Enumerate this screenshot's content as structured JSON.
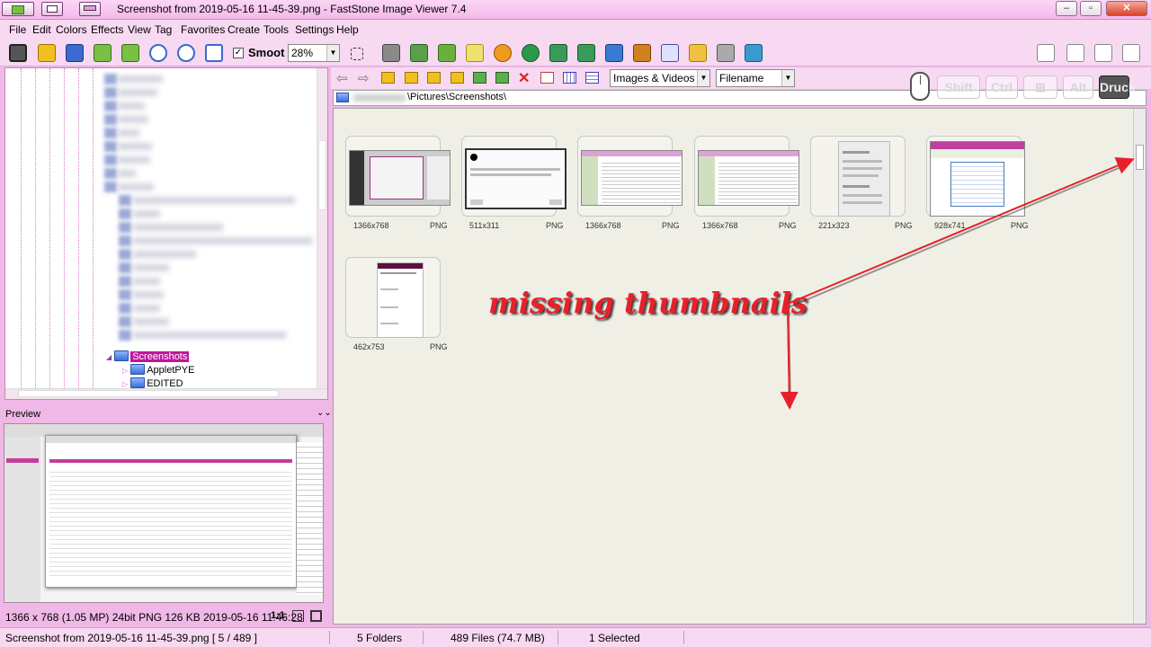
{
  "window": {
    "title": "Screenshot from 2019-05-16 11-45-39.png  -  FastStone Image Viewer 7.4",
    "controls": [
      "–",
      "▫",
      "✕"
    ]
  },
  "menu": [
    "File",
    "Edit",
    "Colors",
    "Effects",
    "View",
    "Tag",
    "Favorites",
    "Create",
    "Tools",
    "Settings",
    "Help"
  ],
  "toolbar": {
    "smooth_label": "Smoot",
    "smooth_checked": true,
    "zoom_value": "28%"
  },
  "tree": {
    "items": [
      {
        "label": "Screenshots",
        "selected": true
      },
      {
        "label": "AppletPYE",
        "selected": false
      },
      {
        "label": "EDITED",
        "selected": false
      }
    ]
  },
  "preview": {
    "label": "Preview",
    "toggle": "⌄⌄",
    "info": "1366 x 768 (1.05 MP)   24bit   PNG    126 KB    2019-05-16 11:46:28",
    "one_to_one": "1:1"
  },
  "nav": {
    "filter": "Images & Videos",
    "sort": "Filename"
  },
  "path": "\\Pictures\\Screenshots\\",
  "keys": [
    "Shift",
    "Ctrl",
    "Alt",
    "Druck"
  ],
  "thumbnails": [
    {
      "dim": "1366x768",
      "fmt": "PNG"
    },
    {
      "dim": "511x311",
      "fmt": "PNG"
    },
    {
      "dim": "1366x768",
      "fmt": "PNG"
    },
    {
      "dim": "1366x768",
      "fmt": "PNG"
    },
    {
      "dim": "221x323",
      "fmt": "PNG"
    },
    {
      "dim": "928x741",
      "fmt": "PNG"
    },
    {
      "dim": "462x753",
      "fmt": "PNG"
    }
  ],
  "annotation": "missing thumbnails",
  "status": {
    "file": "Screenshot from 2019-05-16 11-45-39.png [ 5 / 489 ]",
    "folders": "5 Folders",
    "files": "489 Files (74.7 MB)",
    "selected": "1 Selected"
  },
  "colors": {
    "accent": "#f7d9f2",
    "selection": "#c0159a",
    "annotation": "#e8202a"
  }
}
